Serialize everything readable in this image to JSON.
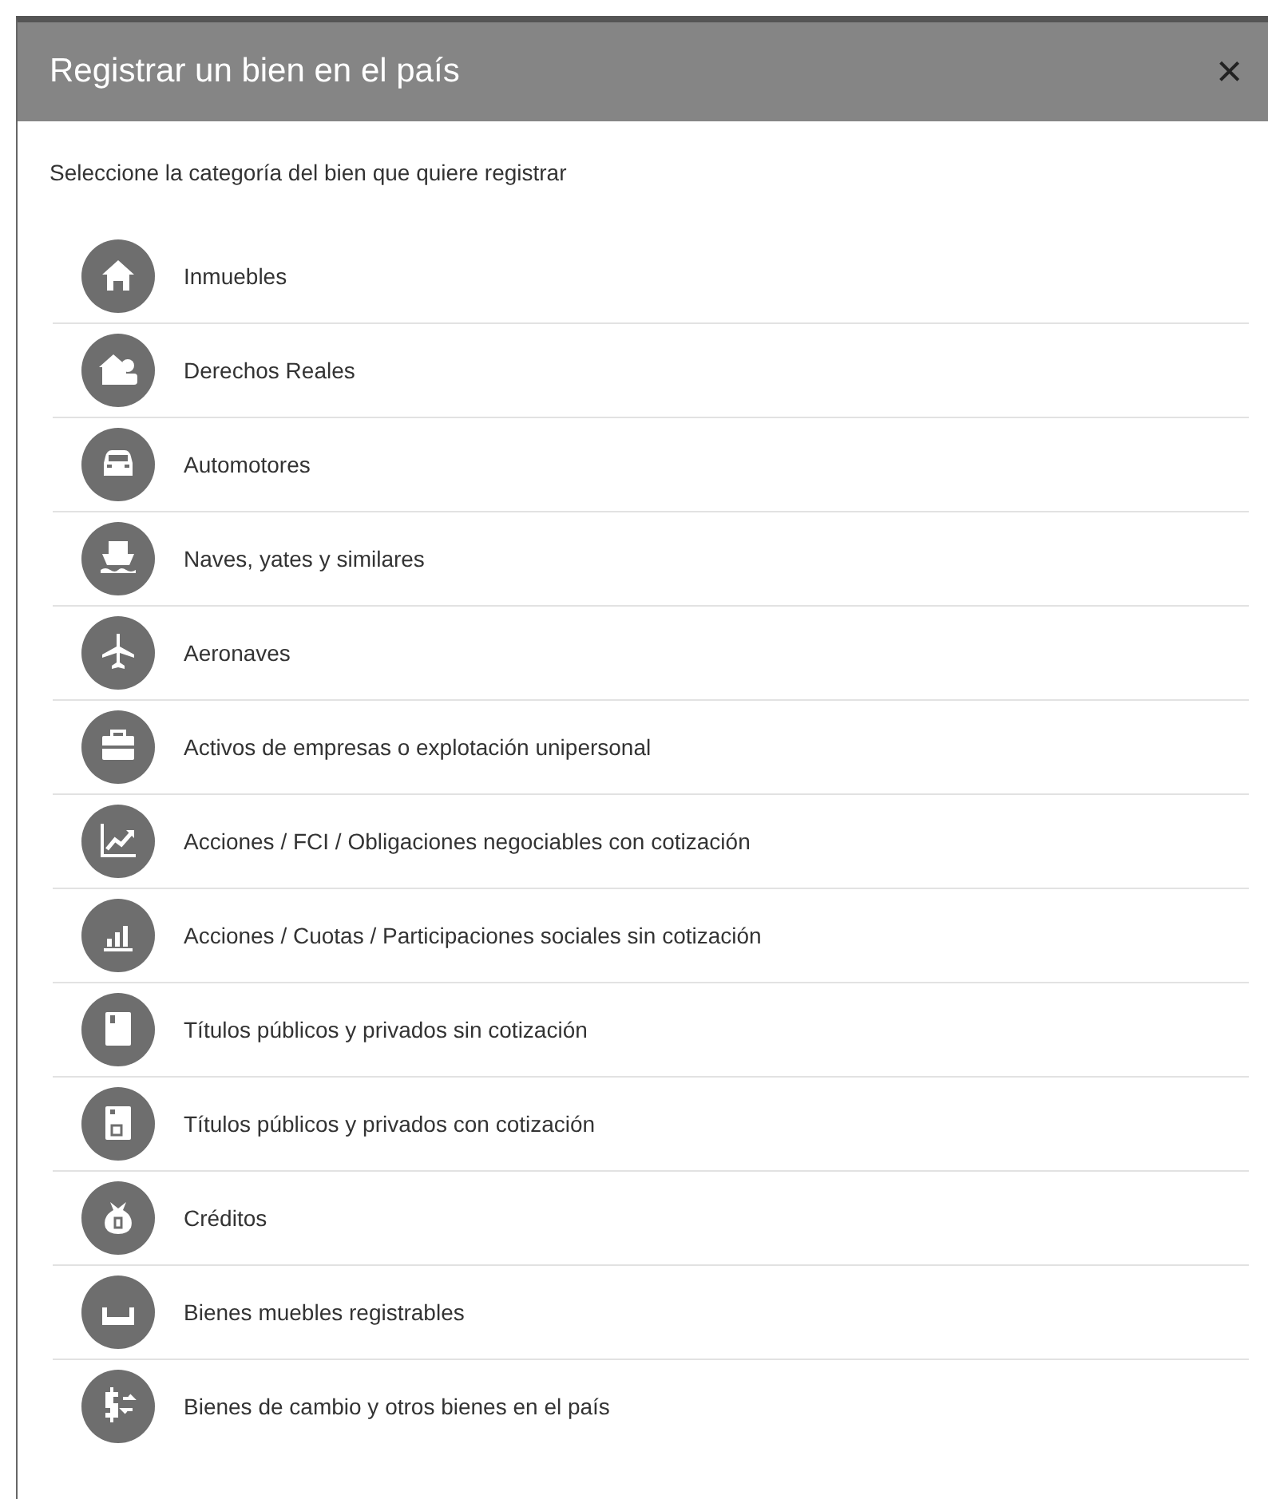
{
  "dialog": {
    "title": "Registrar un bien en el país",
    "close": "×"
  },
  "instruction": "Seleccione la categoría del bien que quiere registrar",
  "categories": [
    {
      "label": "Inmuebles"
    },
    {
      "label": "Derechos Reales"
    },
    {
      "label": "Automotores"
    },
    {
      "label": "Naves, yates y similares"
    },
    {
      "label": "Aeronaves"
    },
    {
      "label": "Activos de empresas o explotación unipersonal"
    },
    {
      "label": "Acciones / FCI / Obligaciones negociables con cotización"
    },
    {
      "label": "Acciones / Cuotas / Participaciones sociales sin cotización"
    },
    {
      "label": "Títulos públicos y privados sin cotización"
    },
    {
      "label": "Títulos públicos y privados con cotización"
    },
    {
      "label": "Créditos"
    },
    {
      "label": "Bienes muebles registrables"
    },
    {
      "label": "Bienes de cambio y otros bienes en el país"
    }
  ]
}
